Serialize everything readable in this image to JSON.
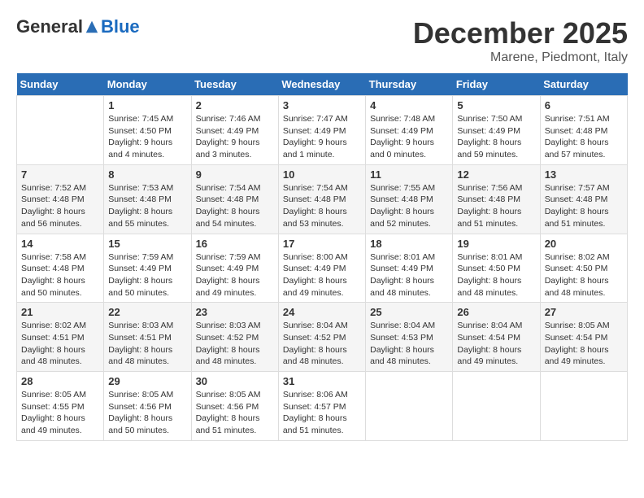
{
  "header": {
    "logo_general": "General",
    "logo_blue": "Blue",
    "month": "December 2025",
    "location": "Marene, Piedmont, Italy"
  },
  "days_of_week": [
    "Sunday",
    "Monday",
    "Tuesday",
    "Wednesday",
    "Thursday",
    "Friday",
    "Saturday"
  ],
  "weeks": [
    [
      {
        "day": "",
        "info": ""
      },
      {
        "day": "1",
        "info": "Sunrise: 7:45 AM\nSunset: 4:50 PM\nDaylight: 9 hours\nand 4 minutes."
      },
      {
        "day": "2",
        "info": "Sunrise: 7:46 AM\nSunset: 4:49 PM\nDaylight: 9 hours\nand 3 minutes."
      },
      {
        "day": "3",
        "info": "Sunrise: 7:47 AM\nSunset: 4:49 PM\nDaylight: 9 hours\nand 1 minute."
      },
      {
        "day": "4",
        "info": "Sunrise: 7:48 AM\nSunset: 4:49 PM\nDaylight: 9 hours\nand 0 minutes."
      },
      {
        "day": "5",
        "info": "Sunrise: 7:50 AM\nSunset: 4:49 PM\nDaylight: 8 hours\nand 59 minutes."
      },
      {
        "day": "6",
        "info": "Sunrise: 7:51 AM\nSunset: 4:48 PM\nDaylight: 8 hours\nand 57 minutes."
      }
    ],
    [
      {
        "day": "7",
        "info": "Sunrise: 7:52 AM\nSunset: 4:48 PM\nDaylight: 8 hours\nand 56 minutes."
      },
      {
        "day": "8",
        "info": "Sunrise: 7:53 AM\nSunset: 4:48 PM\nDaylight: 8 hours\nand 55 minutes."
      },
      {
        "day": "9",
        "info": "Sunrise: 7:54 AM\nSunset: 4:48 PM\nDaylight: 8 hours\nand 54 minutes."
      },
      {
        "day": "10",
        "info": "Sunrise: 7:54 AM\nSunset: 4:48 PM\nDaylight: 8 hours\nand 53 minutes."
      },
      {
        "day": "11",
        "info": "Sunrise: 7:55 AM\nSunset: 4:48 PM\nDaylight: 8 hours\nand 52 minutes."
      },
      {
        "day": "12",
        "info": "Sunrise: 7:56 AM\nSunset: 4:48 PM\nDaylight: 8 hours\nand 51 minutes."
      },
      {
        "day": "13",
        "info": "Sunrise: 7:57 AM\nSunset: 4:48 PM\nDaylight: 8 hours\nand 51 minutes."
      }
    ],
    [
      {
        "day": "14",
        "info": "Sunrise: 7:58 AM\nSunset: 4:48 PM\nDaylight: 8 hours\nand 50 minutes."
      },
      {
        "day": "15",
        "info": "Sunrise: 7:59 AM\nSunset: 4:49 PM\nDaylight: 8 hours\nand 50 minutes."
      },
      {
        "day": "16",
        "info": "Sunrise: 7:59 AM\nSunset: 4:49 PM\nDaylight: 8 hours\nand 49 minutes."
      },
      {
        "day": "17",
        "info": "Sunrise: 8:00 AM\nSunset: 4:49 PM\nDaylight: 8 hours\nand 49 minutes."
      },
      {
        "day": "18",
        "info": "Sunrise: 8:01 AM\nSunset: 4:49 PM\nDaylight: 8 hours\nand 48 minutes."
      },
      {
        "day": "19",
        "info": "Sunrise: 8:01 AM\nSunset: 4:50 PM\nDaylight: 8 hours\nand 48 minutes."
      },
      {
        "day": "20",
        "info": "Sunrise: 8:02 AM\nSunset: 4:50 PM\nDaylight: 8 hours\nand 48 minutes."
      }
    ],
    [
      {
        "day": "21",
        "info": "Sunrise: 8:02 AM\nSunset: 4:51 PM\nDaylight: 8 hours\nand 48 minutes."
      },
      {
        "day": "22",
        "info": "Sunrise: 8:03 AM\nSunset: 4:51 PM\nDaylight: 8 hours\nand 48 minutes."
      },
      {
        "day": "23",
        "info": "Sunrise: 8:03 AM\nSunset: 4:52 PM\nDaylight: 8 hours\nand 48 minutes."
      },
      {
        "day": "24",
        "info": "Sunrise: 8:04 AM\nSunset: 4:52 PM\nDaylight: 8 hours\nand 48 minutes."
      },
      {
        "day": "25",
        "info": "Sunrise: 8:04 AM\nSunset: 4:53 PM\nDaylight: 8 hours\nand 48 minutes."
      },
      {
        "day": "26",
        "info": "Sunrise: 8:04 AM\nSunset: 4:54 PM\nDaylight: 8 hours\nand 49 minutes."
      },
      {
        "day": "27",
        "info": "Sunrise: 8:05 AM\nSunset: 4:54 PM\nDaylight: 8 hours\nand 49 minutes."
      }
    ],
    [
      {
        "day": "28",
        "info": "Sunrise: 8:05 AM\nSunset: 4:55 PM\nDaylight: 8 hours\nand 49 minutes."
      },
      {
        "day": "29",
        "info": "Sunrise: 8:05 AM\nSunset: 4:56 PM\nDaylight: 8 hours\nand 50 minutes."
      },
      {
        "day": "30",
        "info": "Sunrise: 8:05 AM\nSunset: 4:56 PM\nDaylight: 8 hours\nand 51 minutes."
      },
      {
        "day": "31",
        "info": "Sunrise: 8:06 AM\nSunset: 4:57 PM\nDaylight: 8 hours\nand 51 minutes."
      },
      {
        "day": "",
        "info": ""
      },
      {
        "day": "",
        "info": ""
      },
      {
        "day": "",
        "info": ""
      }
    ]
  ]
}
